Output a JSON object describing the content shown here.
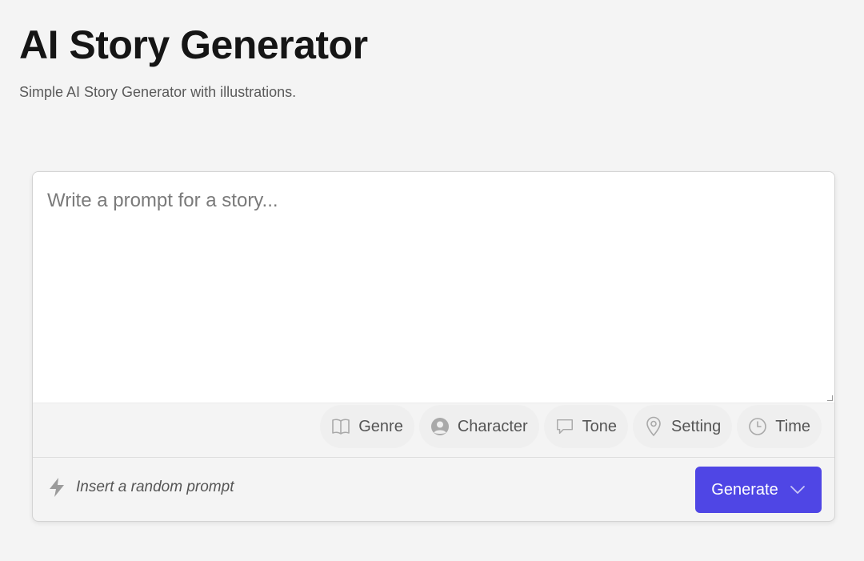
{
  "header": {
    "title": "AI Story Generator",
    "subtitle": "Simple AI Story Generator with illustrations."
  },
  "prompt": {
    "placeholder": "Write a prompt for a story...",
    "value": ""
  },
  "chips": [
    {
      "label": "Genre",
      "icon": "book-icon"
    },
    {
      "label": "Character",
      "icon": "user-circle-icon"
    },
    {
      "label": "Tone",
      "icon": "speech-bubble-icon"
    },
    {
      "label": "Setting",
      "icon": "map-pin-icon"
    },
    {
      "label": "Time",
      "icon": "clock-icon"
    }
  ],
  "footer": {
    "random_label": "Insert a random prompt",
    "random_icon": "lightning-icon",
    "generate_label": "Generate",
    "generate_icon": "chevron-down-icon"
  },
  "colors": {
    "accent": "#4f46e5",
    "background": "#f4f4f4"
  }
}
